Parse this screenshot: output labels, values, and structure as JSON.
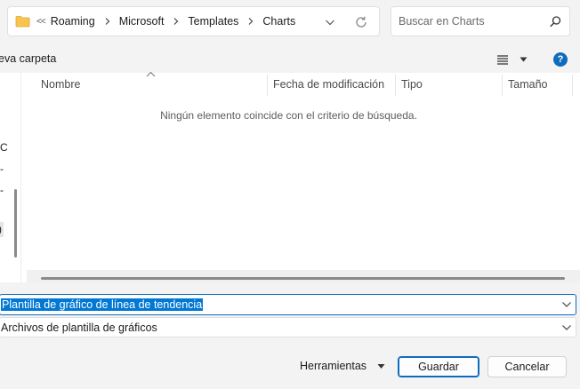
{
  "address": {
    "overflow_marker": "<<",
    "crumbs": [
      "Roaming",
      "Microsoft",
      "Templates",
      "Charts"
    ]
  },
  "search": {
    "placeholder": "Buscar en Charts"
  },
  "toolbar": {
    "new_folder_label": "eva carpeta",
    "help_label": "?"
  },
  "nav_fragments": [
    "C",
    "-",
    "-",
    ")"
  ],
  "columns": [
    "Nombre",
    "Fecha de modificación",
    "Tipo",
    "Tamaño"
  ],
  "empty_message": "Ningún elemento coincide con el criterio de búsqueda.",
  "filename": {
    "value": "Plantilla de gráfico de línea de tendencia"
  },
  "filetype": {
    "value": "Archivos de plantilla de gráficos"
  },
  "buttons": {
    "tools": "Herramientas",
    "save": "Guardar",
    "cancel": "Cancelar"
  },
  "colors": {
    "accent": "#0f6cbd",
    "folder": "#f8c44f",
    "selection": "#0078d4"
  }
}
